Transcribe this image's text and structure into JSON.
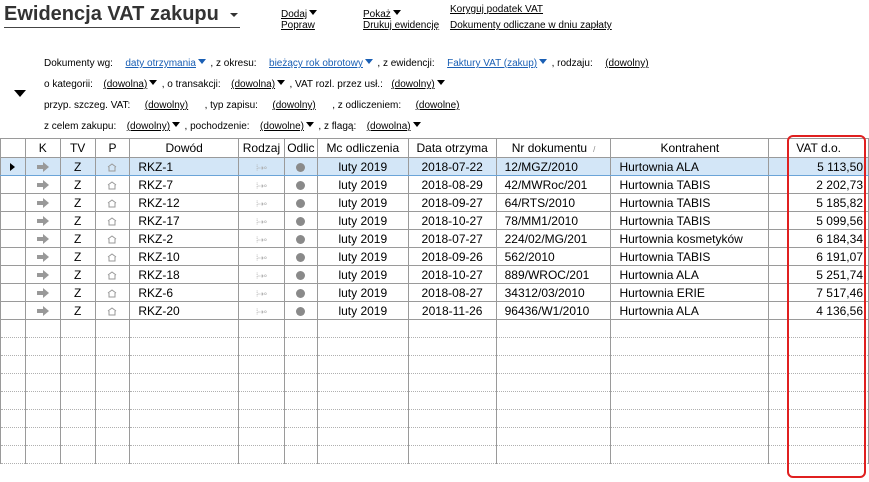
{
  "window": {
    "title": "Ewidencja VAT zakupu"
  },
  "actions": {
    "dodaj": "Dodaj",
    "popraw": "Popraw",
    "pokaz": "Pokaż",
    "drukuj": "Drukuj ewidencję",
    "koryguj": "Koryguj podatek VAT",
    "dokumenty_odliczane": "Dokumenty odliczane w dniu zapłaty"
  },
  "filters": {
    "dokumenty_wg_label": "Dokumenty wg:",
    "dokumenty_wg_value": "daty otrzymania",
    "z_okresu_label": ", z okresu:",
    "z_okresu_value": "bieżący rok obrotowy",
    "z_ewidencji_label": ", z ewidencji:",
    "z_ewidencji_value": "Faktury VAT (zakup)",
    "rodzaju_label": ", rodzaju:",
    "rodzaju_value": "(dowolny)",
    "o_kategorii_label": "o kategorii:",
    "o_kategorii_value": "(dowolna)",
    "o_transakcji_label": ", o transakcji:",
    "o_transakcji_value": "(dowolna)",
    "vat_rozl_label": ", VAT rozl. przez usł.:",
    "vat_rozl_value": "(dowolny)",
    "przyp_label": "przyp. szczeg. VAT:",
    "przyp_value": "(dowolny)",
    "typ_zapisu_label": ", typ zapisu:",
    "typ_zapisu_value": "(dowolny)",
    "z_odliczeniem_label": ", z odliczeniem:",
    "z_odliczeniem_value": "(dowolne)",
    "z_celem_label": "z celem zakupu:",
    "z_celem_value": "(dowolny)",
    "pochodzenie_label": ", pochodzenie:",
    "pochodzenie_value": "(dowolne)",
    "z_flaga_label": ", z flagą:",
    "z_flaga_value": "(dowolna)"
  },
  "table": {
    "columns": [
      "K",
      "TV",
      "P",
      "Dowód",
      "Rodzaj",
      "Odlic",
      "Mc odliczenia",
      "Data otrzyma",
      "Nr dokumentu",
      "Kontrahent",
      "VAT d.o."
    ],
    "rows": [
      {
        "tv": "Z",
        "dowod": "RKZ-1",
        "mc": "luty 2019",
        "data": "2018-07-22",
        "nr": "12/MGZ/2010",
        "kontrahent": "Hurtownia ALA",
        "vat": "5 113,50"
      },
      {
        "tv": "Z",
        "dowod": "RKZ-7",
        "mc": "luty 2019",
        "data": "2018-08-29",
        "nr": "42/MWRoc/201",
        "kontrahent": "Hurtownia TABIS",
        "vat": "2 202,73"
      },
      {
        "tv": "Z",
        "dowod": "RKZ-12",
        "mc": "luty 2019",
        "data": "2018-09-27",
        "nr": "64/RTS/2010",
        "kontrahent": "Hurtownia TABIS",
        "vat": "5 185,82"
      },
      {
        "tv": "Z",
        "dowod": "RKZ-17",
        "mc": "luty 2019",
        "data": "2018-10-27",
        "nr": "78/MM1/2010",
        "kontrahent": "Hurtownia TABIS",
        "vat": "5 099,56"
      },
      {
        "tv": "Z",
        "dowod": "RKZ-2",
        "mc": "luty 2019",
        "data": "2018-07-27",
        "nr": "224/02/MG/201",
        "kontrahent": "Hurtownia kosmetyków",
        "vat": "6 184,34"
      },
      {
        "tv": "Z",
        "dowod": "RKZ-10",
        "mc": "luty 2019",
        "data": "2018-09-26",
        "nr": "562/2010",
        "kontrahent": "Hurtownia TABIS",
        "vat": "6 191,07"
      },
      {
        "tv": "Z",
        "dowod": "RKZ-18",
        "mc": "luty 2019",
        "data": "2018-10-27",
        "nr": "889/WROC/201",
        "kontrahent": "Hurtownia ALA",
        "vat": "5 251,74"
      },
      {
        "tv": "Z",
        "dowod": "RKZ-6",
        "mc": "luty 2019",
        "data": "2018-08-27",
        "nr": "34312/03/2010",
        "kontrahent": "Hurtownia ERIE",
        "vat": "7 517,46"
      },
      {
        "tv": "Z",
        "dowod": "RKZ-20",
        "mc": "luty 2019",
        "data": "2018-11-26",
        "nr": "96436/W1/2010",
        "kontrahent": "Hurtownia ALA",
        "vat": "4 136,56"
      }
    ],
    "empty_rows": 8,
    "selected_row": 0
  },
  "colors": {
    "selection": "#d3e6f7",
    "link_blue": "#1a5fb4",
    "highlight_red": "#e02020"
  },
  "icons": {
    "k_column": "arrow-right-icon",
    "p_column": "house-icon",
    "rodzaj_column": "transfer-arrows-icon",
    "odlic_column": "dot-icon"
  }
}
